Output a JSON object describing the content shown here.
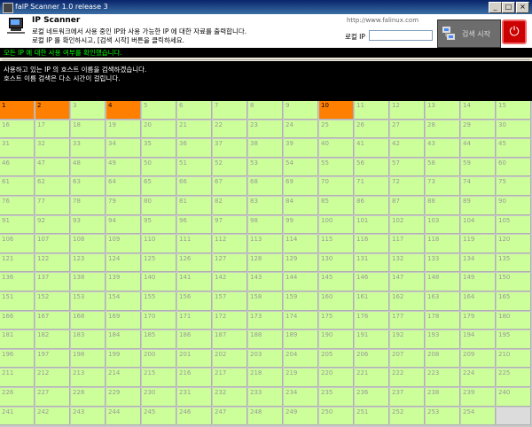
{
  "window": {
    "title": "falP Scanner 1.0 release 3",
    "minimize": "_",
    "maximize": "□",
    "close": "×"
  },
  "header": {
    "title": "IP Scanner",
    "desc_line1": "로컬 네트워크에서 사용 중인 IP와 사용 가능한 IP 에 대한 자료를 출력합니다.",
    "desc_line2": "로컬 IP 를 확인하시고, [검색 시작] 버튼을 클릭하세요.",
    "url": "http://www.falinux.com",
    "ip_label": "로컬 IP",
    "ip_value": "",
    "scan_button": "검색 시작",
    "power_icon": "power-icon"
  },
  "status_text": "모든 IP 에 대한 사용 여부를 확인했습니다.",
  "console_lines": [
    "사용하고 있는 IP 의 호스트 이름을 검색하겠습니다.",
    "호스트 이름 검색은 다소 시간이 걸립니다."
  ],
  "active_ips": [
    1,
    2,
    4,
    10
  ],
  "colors": {
    "active": "#ff8000",
    "inactive": "#ccff99",
    "empty": "#dcdcdc"
  }
}
